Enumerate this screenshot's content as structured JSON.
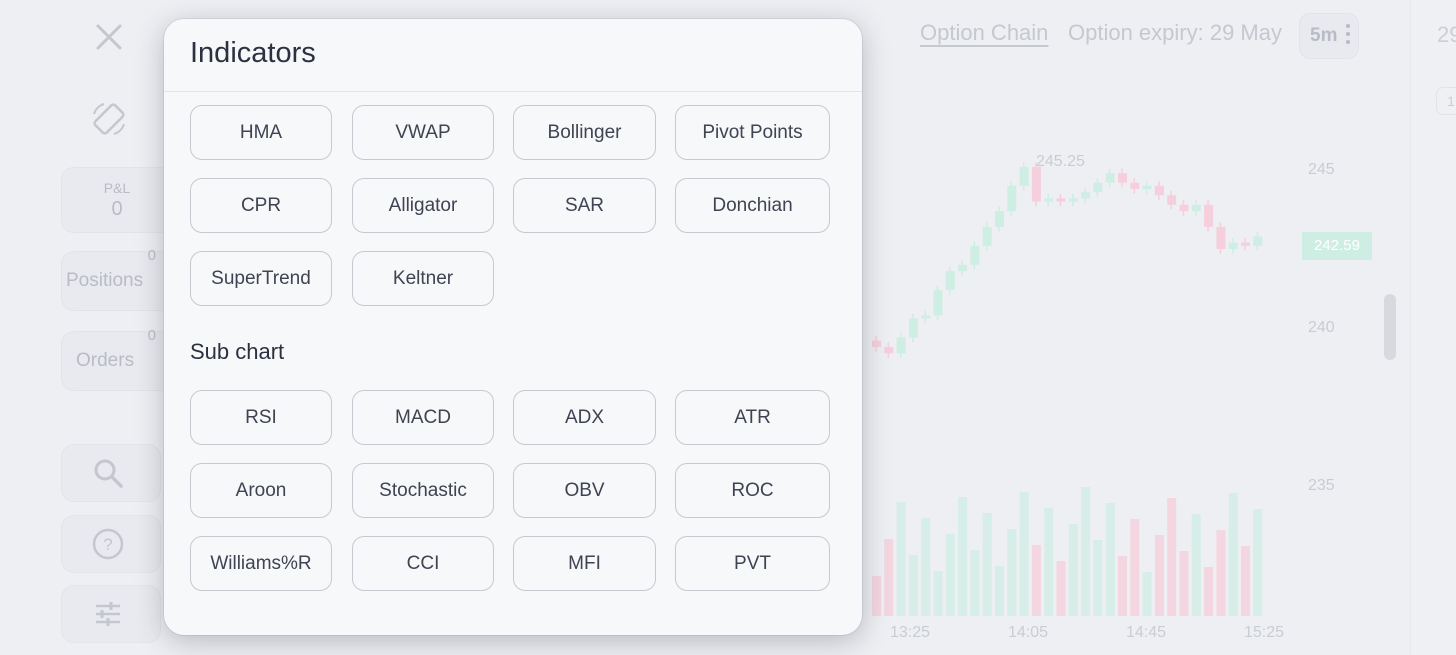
{
  "background": {
    "close_icon": "close-icon",
    "rotate_icon": "rotate-screen-icon",
    "pnl": {
      "label": "P&L",
      "value": "0"
    },
    "positions": {
      "label": "Positions",
      "count": "0"
    },
    "orders": {
      "label": "Orders",
      "count": "0"
    },
    "rail_icons": [
      "search-icon",
      "help-icon",
      "sliders-icon"
    ],
    "option_chain_label": "Option Chain",
    "option_expiry_label": "Option expiry: 29 May",
    "timeframe": "5m",
    "last_price": "242.59",
    "high_marker": "245.25",
    "y_axis": [
      "245",
      "240",
      "235"
    ],
    "x_axis": [
      "13:25",
      "14:05",
      "14:45",
      "15:25"
    ],
    "right_panel_partial": "29",
    "right_panel_sub": "1"
  },
  "modal": {
    "title": "Indicators",
    "overlays": [
      "HMA",
      "VWAP",
      "Bollinger",
      "Pivot Points",
      "CPR",
      "Alligator",
      "SAR",
      "Donchian",
      "SuperTrend",
      "Keltner"
    ],
    "sub_chart_title": "Sub chart",
    "sub_charts": [
      "RSI",
      "MACD",
      "ADX",
      "ATR",
      "Aroon",
      "Stochastic",
      "OBV",
      "ROC",
      "Williams%R",
      "CCI",
      "MFI",
      "PVT"
    ]
  },
  "colors": {
    "up": "#cfeee3",
    "down": "#f5cfdc",
    "modal_bg": "#f7f8fa",
    "button_border": "#c7c9d0"
  }
}
